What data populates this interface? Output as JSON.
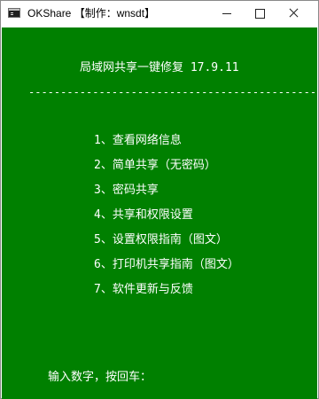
{
  "window": {
    "title": "OKShare 【制作：wnsdt】",
    "icon": "console-icon"
  },
  "console": {
    "colors": {
      "background": "#008000",
      "foreground": "#ffffff"
    },
    "header": "局域网共享一键修复 17.9.11",
    "divider": "-----------------------------------------------",
    "menu": [
      "1、查看网络信息",
      "2、简单共享（无密码）",
      "3、密码共享",
      "4、共享和权限设置",
      "5、设置权限指南（图文）",
      "6、打印机共享指南（图文）",
      "7、软件更新与反馈"
    ],
    "prompt": "输入数字，按回车："
  }
}
